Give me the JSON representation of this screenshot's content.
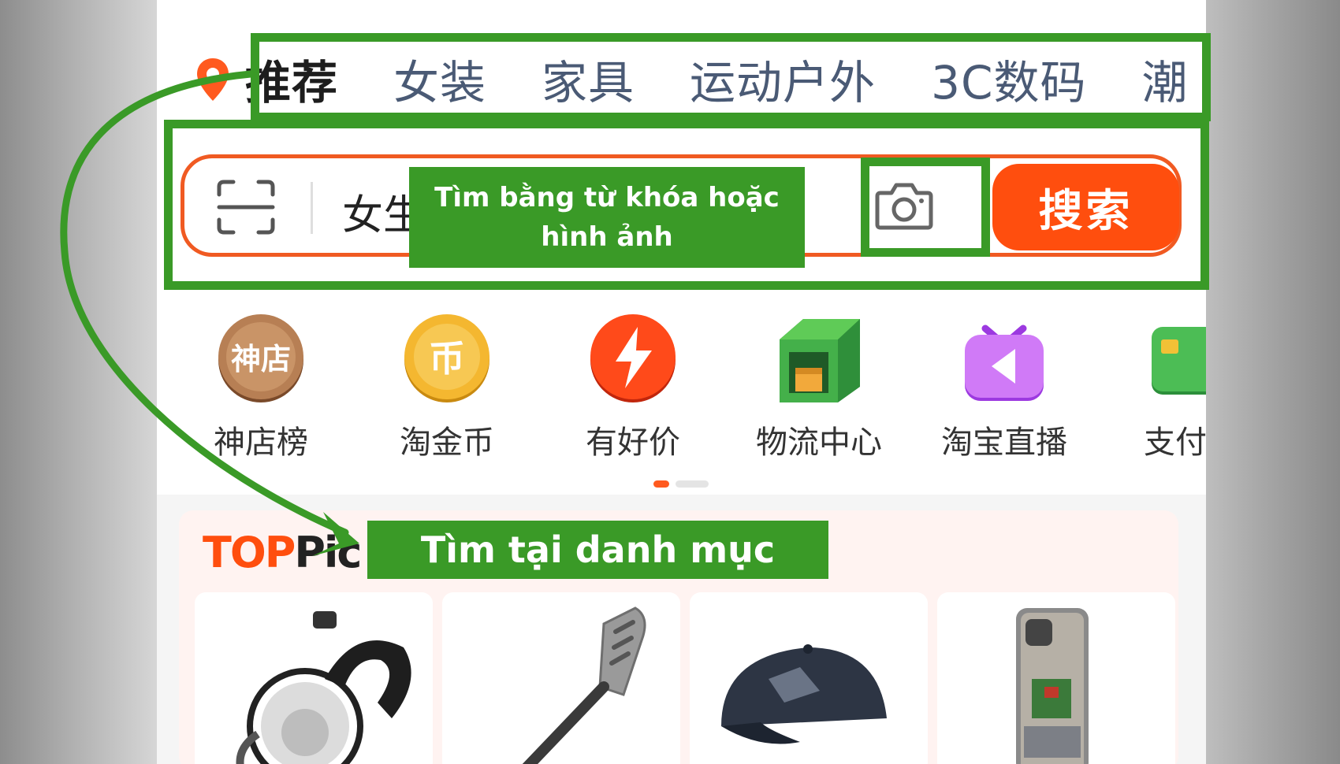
{
  "category_tabs": [
    "推荐",
    "女装",
    "家具",
    "运动户外",
    "3C数码",
    "潮"
  ],
  "search": {
    "query_text": "女生",
    "button_label": "搜索"
  },
  "quick_icons": [
    {
      "label": "神店榜",
      "icon": "shop-ranking-coin-icon",
      "badge": "神店"
    },
    {
      "label": "淘金币",
      "icon": "gold-coin-icon",
      "badge": "币"
    },
    {
      "label": "有好价",
      "icon": "lightning-deal-icon"
    },
    {
      "label": "物流中心",
      "icon": "logistics-box-icon"
    },
    {
      "label": "淘宝直播",
      "icon": "live-tv-icon"
    },
    {
      "label": "支付中",
      "icon": "payment-card-icon"
    }
  ],
  "top_picks": {
    "title_top": "TOP",
    "title_rest": "Pic",
    "products": [
      {
        "icon": "retractable-leash-icon"
      },
      {
        "icon": "spatula-icon"
      },
      {
        "icon": "baseball-cap-icon"
      },
      {
        "icon": "phone-case-icon"
      }
    ]
  },
  "annotations": {
    "search_note": "Tìm bằng từ khóa hoặc hình ảnh",
    "category_note": "Tìm tại danh mục"
  },
  "colors": {
    "brand_orange": "#ff4e0e",
    "annotation_green": "#3a9a27"
  }
}
